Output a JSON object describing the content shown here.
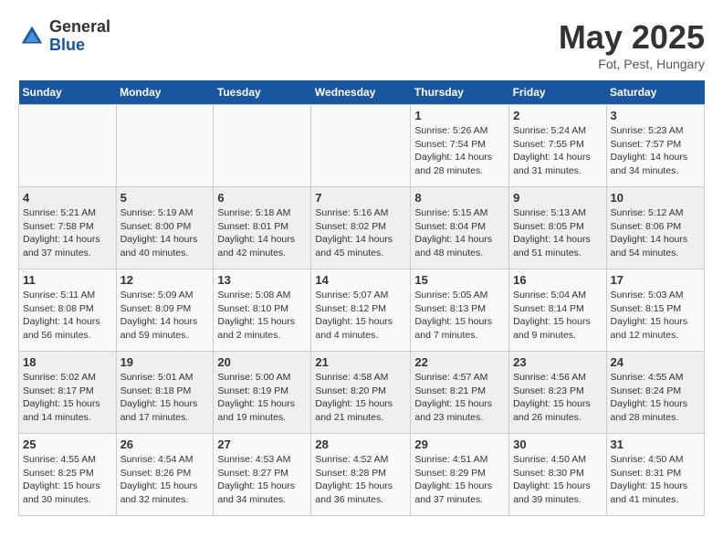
{
  "header": {
    "logo_general": "General",
    "logo_blue": "Blue",
    "month": "May 2025",
    "location": "Fot, Pest, Hungary"
  },
  "days_of_week": [
    "Sunday",
    "Monday",
    "Tuesday",
    "Wednesday",
    "Thursday",
    "Friday",
    "Saturday"
  ],
  "weeks": [
    [
      {
        "day": "",
        "info": ""
      },
      {
        "day": "",
        "info": ""
      },
      {
        "day": "",
        "info": ""
      },
      {
        "day": "",
        "info": ""
      },
      {
        "day": "1",
        "info": "Sunrise: 5:26 AM\nSunset: 7:54 PM\nDaylight: 14 hours\nand 28 minutes."
      },
      {
        "day": "2",
        "info": "Sunrise: 5:24 AM\nSunset: 7:55 PM\nDaylight: 14 hours\nand 31 minutes."
      },
      {
        "day": "3",
        "info": "Sunrise: 5:23 AM\nSunset: 7:57 PM\nDaylight: 14 hours\nand 34 minutes."
      }
    ],
    [
      {
        "day": "4",
        "info": "Sunrise: 5:21 AM\nSunset: 7:58 PM\nDaylight: 14 hours\nand 37 minutes."
      },
      {
        "day": "5",
        "info": "Sunrise: 5:19 AM\nSunset: 8:00 PM\nDaylight: 14 hours\nand 40 minutes."
      },
      {
        "day": "6",
        "info": "Sunrise: 5:18 AM\nSunset: 8:01 PM\nDaylight: 14 hours\nand 42 minutes."
      },
      {
        "day": "7",
        "info": "Sunrise: 5:16 AM\nSunset: 8:02 PM\nDaylight: 14 hours\nand 45 minutes."
      },
      {
        "day": "8",
        "info": "Sunrise: 5:15 AM\nSunset: 8:04 PM\nDaylight: 14 hours\nand 48 minutes."
      },
      {
        "day": "9",
        "info": "Sunrise: 5:13 AM\nSunset: 8:05 PM\nDaylight: 14 hours\nand 51 minutes."
      },
      {
        "day": "10",
        "info": "Sunrise: 5:12 AM\nSunset: 8:06 PM\nDaylight: 14 hours\nand 54 minutes."
      }
    ],
    [
      {
        "day": "11",
        "info": "Sunrise: 5:11 AM\nSunset: 8:08 PM\nDaylight: 14 hours\nand 56 minutes."
      },
      {
        "day": "12",
        "info": "Sunrise: 5:09 AM\nSunset: 8:09 PM\nDaylight: 14 hours\nand 59 minutes."
      },
      {
        "day": "13",
        "info": "Sunrise: 5:08 AM\nSunset: 8:10 PM\nDaylight: 15 hours\nand 2 minutes."
      },
      {
        "day": "14",
        "info": "Sunrise: 5:07 AM\nSunset: 8:12 PM\nDaylight: 15 hours\nand 4 minutes."
      },
      {
        "day": "15",
        "info": "Sunrise: 5:05 AM\nSunset: 8:13 PM\nDaylight: 15 hours\nand 7 minutes."
      },
      {
        "day": "16",
        "info": "Sunrise: 5:04 AM\nSunset: 8:14 PM\nDaylight: 15 hours\nand 9 minutes."
      },
      {
        "day": "17",
        "info": "Sunrise: 5:03 AM\nSunset: 8:15 PM\nDaylight: 15 hours\nand 12 minutes."
      }
    ],
    [
      {
        "day": "18",
        "info": "Sunrise: 5:02 AM\nSunset: 8:17 PM\nDaylight: 15 hours\nand 14 minutes."
      },
      {
        "day": "19",
        "info": "Sunrise: 5:01 AM\nSunset: 8:18 PM\nDaylight: 15 hours\nand 17 minutes."
      },
      {
        "day": "20",
        "info": "Sunrise: 5:00 AM\nSunset: 8:19 PM\nDaylight: 15 hours\nand 19 minutes."
      },
      {
        "day": "21",
        "info": "Sunrise: 4:58 AM\nSunset: 8:20 PM\nDaylight: 15 hours\nand 21 minutes."
      },
      {
        "day": "22",
        "info": "Sunrise: 4:57 AM\nSunset: 8:21 PM\nDaylight: 15 hours\nand 23 minutes."
      },
      {
        "day": "23",
        "info": "Sunrise: 4:56 AM\nSunset: 8:23 PM\nDaylight: 15 hours\nand 26 minutes."
      },
      {
        "day": "24",
        "info": "Sunrise: 4:55 AM\nSunset: 8:24 PM\nDaylight: 15 hours\nand 28 minutes."
      }
    ],
    [
      {
        "day": "25",
        "info": "Sunrise: 4:55 AM\nSunset: 8:25 PM\nDaylight: 15 hours\nand 30 minutes."
      },
      {
        "day": "26",
        "info": "Sunrise: 4:54 AM\nSunset: 8:26 PM\nDaylight: 15 hours\nand 32 minutes."
      },
      {
        "day": "27",
        "info": "Sunrise: 4:53 AM\nSunset: 8:27 PM\nDaylight: 15 hours\nand 34 minutes."
      },
      {
        "day": "28",
        "info": "Sunrise: 4:52 AM\nSunset: 8:28 PM\nDaylight: 15 hours\nand 36 minutes."
      },
      {
        "day": "29",
        "info": "Sunrise: 4:51 AM\nSunset: 8:29 PM\nDaylight: 15 hours\nand 37 minutes."
      },
      {
        "day": "30",
        "info": "Sunrise: 4:50 AM\nSunset: 8:30 PM\nDaylight: 15 hours\nand 39 minutes."
      },
      {
        "day": "31",
        "info": "Sunrise: 4:50 AM\nSunset: 8:31 PM\nDaylight: 15 hours\nand 41 minutes."
      }
    ]
  ]
}
